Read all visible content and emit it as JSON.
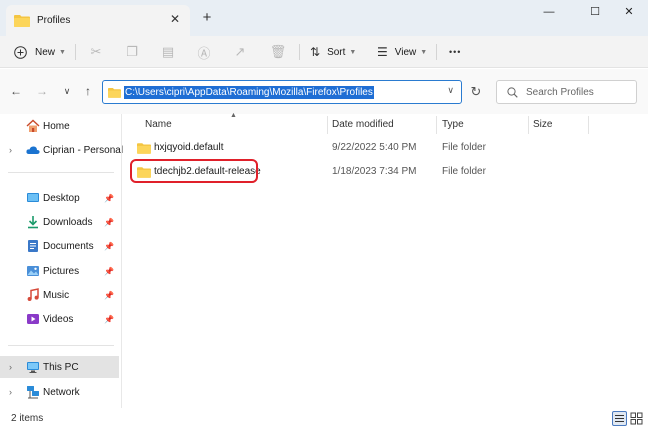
{
  "window": {
    "tab_title": "Profiles",
    "tab_close": "✕",
    "new_tab": "+",
    "minimize": "—",
    "maximize": "☐",
    "close": "✕"
  },
  "toolbar": {
    "new_label": "New",
    "sort_label": "Sort",
    "view_label": "View",
    "more_label": "•••"
  },
  "address": {
    "path": "C:\\Users\\cipri\\AppData\\Roaming\\Mozilla\\Firefox\\Profiles",
    "search_placeholder": "Search Profiles"
  },
  "sidebar": {
    "items": [
      {
        "label": "Home"
      },
      {
        "label": "Ciprian - Personal"
      },
      {
        "label": "Desktop"
      },
      {
        "label": "Downloads"
      },
      {
        "label": "Documents"
      },
      {
        "label": "Pictures"
      },
      {
        "label": "Music"
      },
      {
        "label": "Videos"
      },
      {
        "label": "This PC"
      },
      {
        "label": "Network"
      }
    ]
  },
  "columns": {
    "name": "Name",
    "date": "Date modified",
    "type": "Type",
    "size": "Size"
  },
  "files": [
    {
      "name": "hxjqyoid.default",
      "date": "9/22/2022 5:40 PM",
      "type": "File folder"
    },
    {
      "name": "tdechjb2.default-release",
      "date": "1/18/2023 7:34 PM",
      "type": "File folder"
    }
  ],
  "status": {
    "count": "2 items"
  },
  "colors": {
    "accent": "#1f6ed4",
    "folder": "#f4c542",
    "highlight": "#e0202a"
  }
}
